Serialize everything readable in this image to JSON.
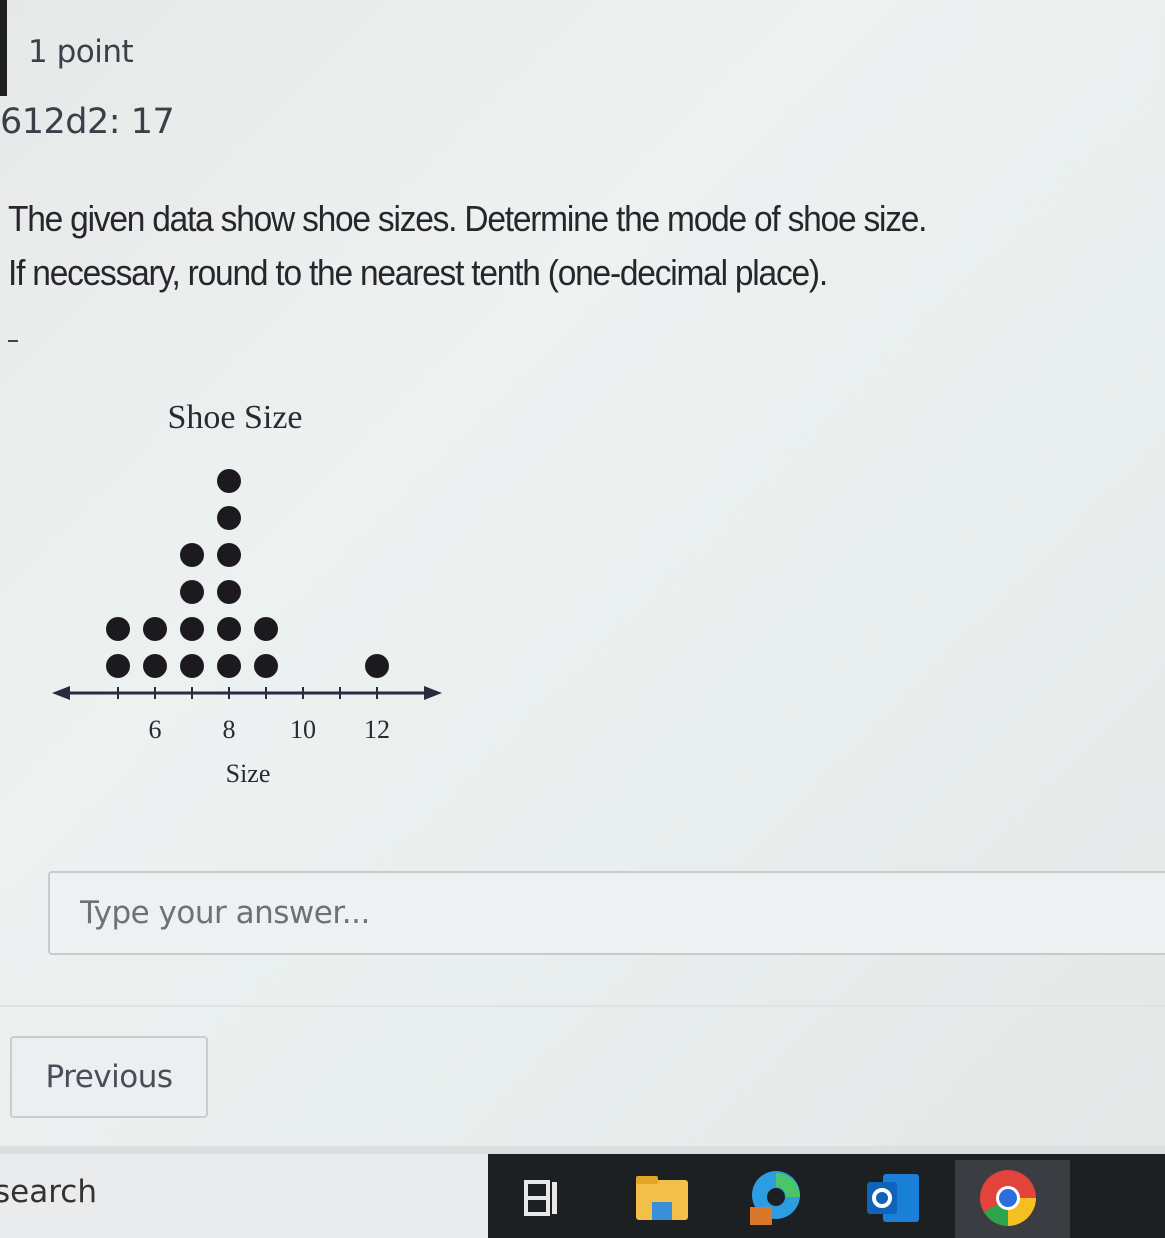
{
  "question": {
    "points": "1 point",
    "id_line": "612d2: 17",
    "text_line1": "The given data show shoe sizes. Determine the mode of shoe size.",
    "text_line2": "If necessary, round to the nearest tenth (one-decimal place)."
  },
  "chart_data": {
    "type": "dot-plot",
    "title": "Shoe Size",
    "xlabel": "Size",
    "ylabel": "",
    "x_range": [
      4,
      13
    ],
    "ticks": [
      5,
      6,
      7,
      8,
      9,
      10,
      11,
      12
    ],
    "tick_labels": [
      {
        "value": 6,
        "label": "6"
      },
      {
        "value": 8,
        "label": "8"
      },
      {
        "value": 10,
        "label": "10"
      },
      {
        "value": 12,
        "label": "12"
      }
    ],
    "categories": [
      5,
      6,
      7,
      8,
      9,
      10,
      11,
      12
    ],
    "values": [
      2,
      2,
      4,
      6,
      2,
      0,
      0,
      1
    ],
    "grid": false
  },
  "answer": {
    "placeholder": "Type your answer...",
    "value": ""
  },
  "nav": {
    "previous_label": "Previous"
  },
  "taskbar": {
    "search_label": "search",
    "icons": [
      "task-view-icon",
      "file-explorer-icon",
      "edge-icon",
      "outlook-icon",
      "chrome-icon"
    ]
  }
}
